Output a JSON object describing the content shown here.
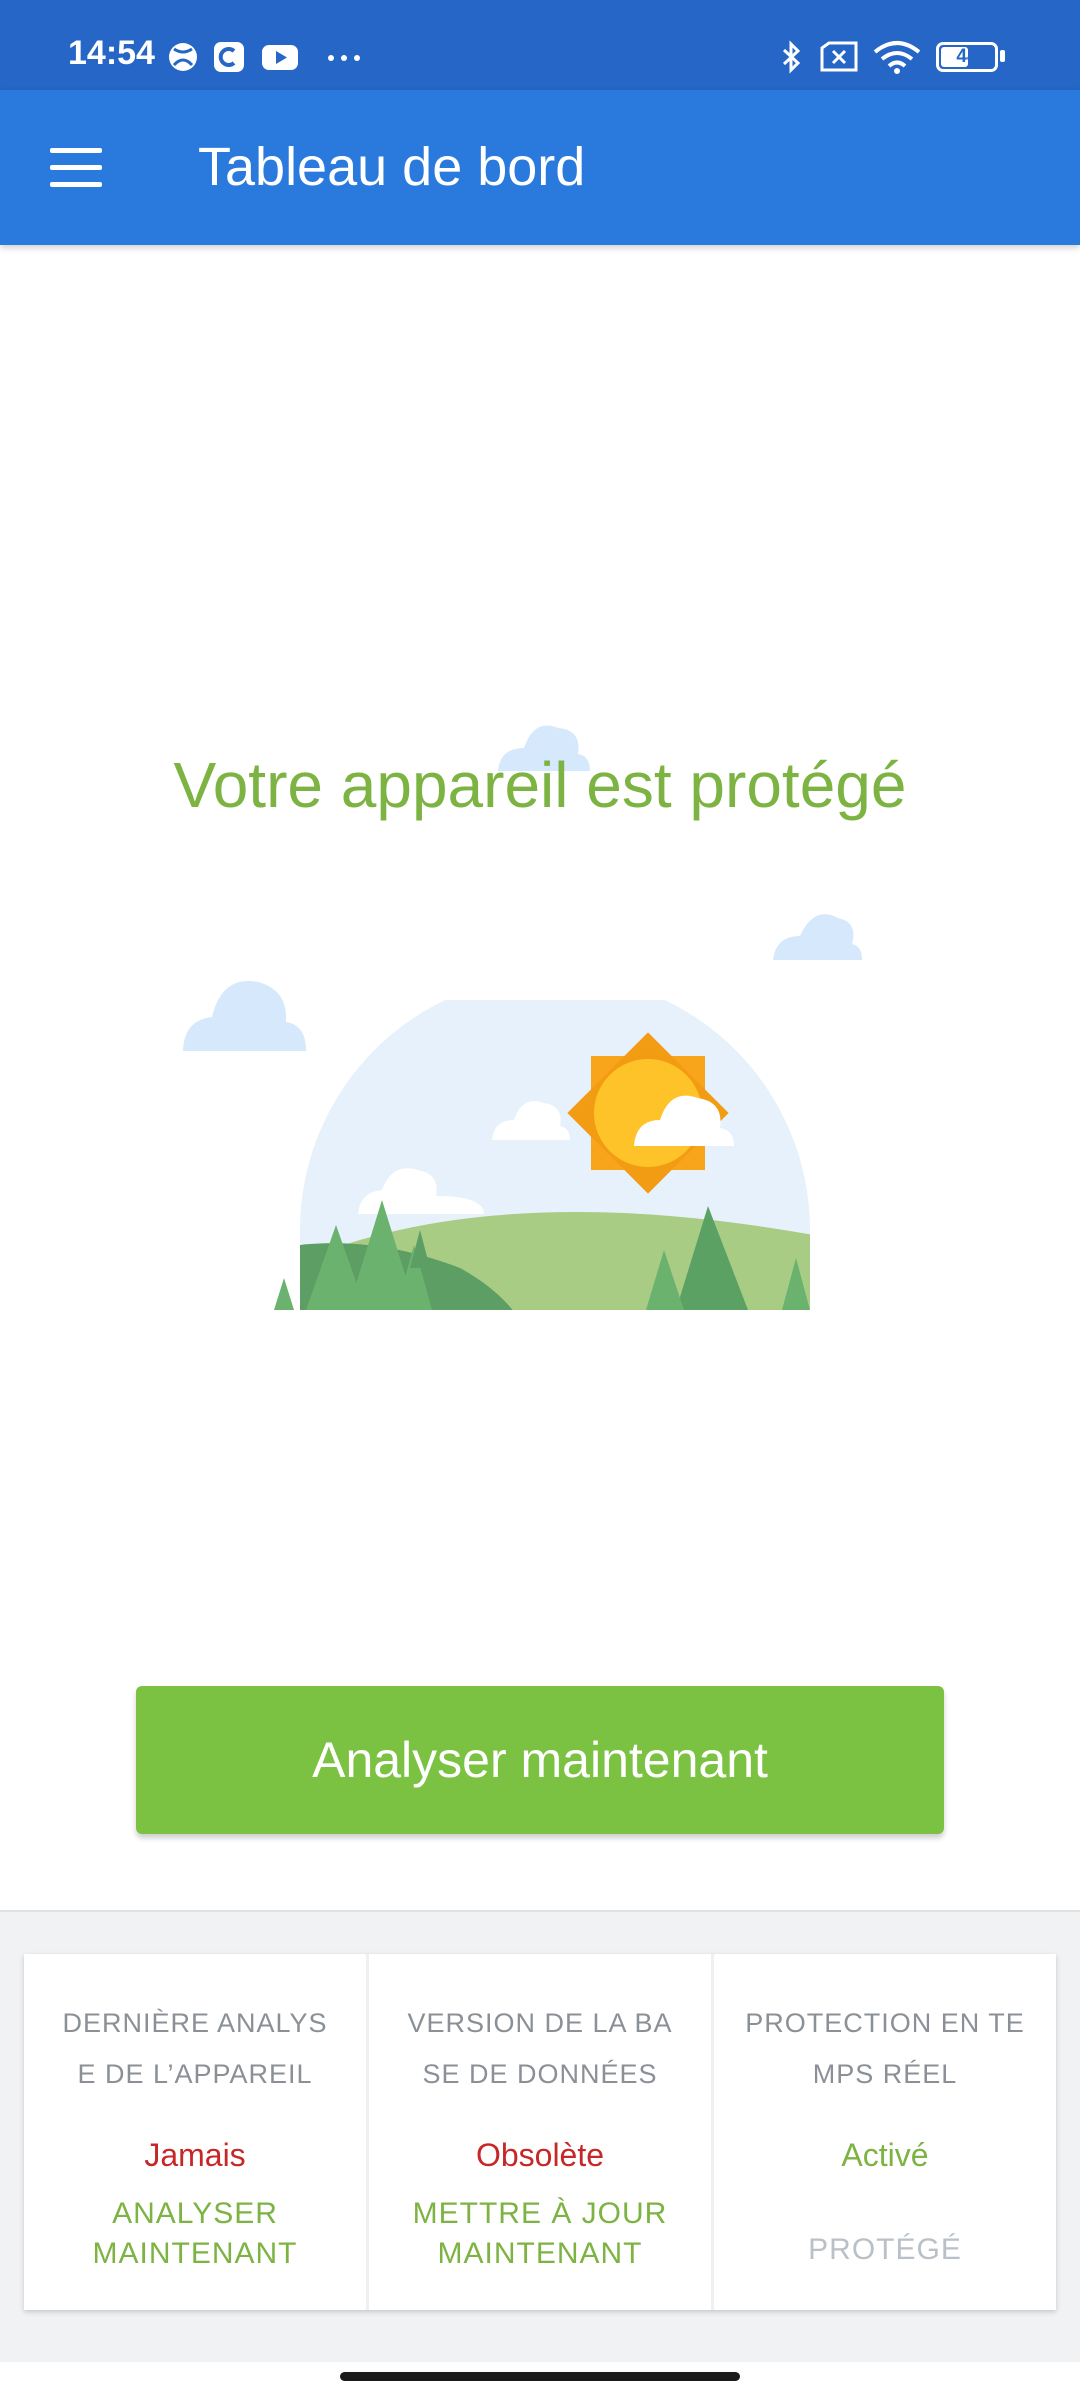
{
  "status_bar": {
    "time": "14:54",
    "battery": "44",
    "icons": [
      "xbox-icon",
      "chat-app-icon",
      "youtube-icon",
      "more-dots-icon",
      "bluetooth-icon",
      "no-sim-icon",
      "wifi-icon",
      "battery-icon"
    ]
  },
  "app_bar": {
    "title": "Tableau de bord",
    "menu_icon": "hamburger-menu-icon"
  },
  "main": {
    "headline": "Votre appareil est protégé",
    "illustration": "sunny-landscape-illustration",
    "scan_button": "Analyser maintenant"
  },
  "cards": [
    {
      "label": "DERNIÈRE ANALYSE DE L’APPAREIL",
      "status": "Jamais",
      "status_color": "#c62828",
      "action": "ANALYSER MAINTENANT"
    },
    {
      "label": "VERSION DE LA BASE DE DONNÉES",
      "status": "Obsolète",
      "status_color": "#c62828",
      "action": "METTRE À JOUR MAINTENANT"
    },
    {
      "label": "PROTECTION EN TEMPS RÉEL",
      "status": "Activé",
      "status_color": "#7cb342",
      "action": "PROTÉGÉ"
    }
  ],
  "colors": {
    "status_bar": "#2566c6",
    "app_bar": "#2a7ade",
    "accent_green": "#7cc242",
    "alert_red": "#c62828"
  }
}
